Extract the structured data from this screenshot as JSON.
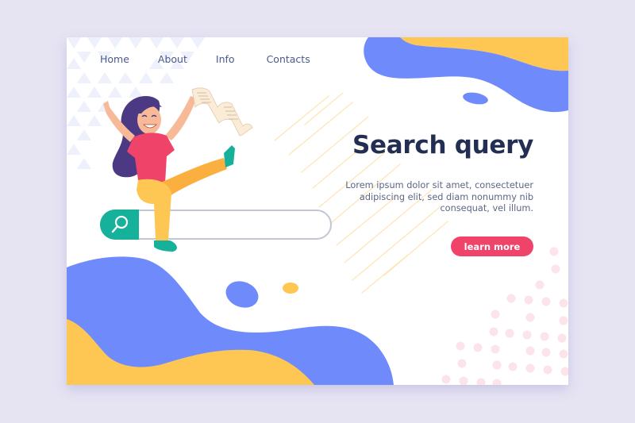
{
  "nav": {
    "items": [
      {
        "label": "Home"
      },
      {
        "label": "About"
      },
      {
        "label": "Info"
      },
      {
        "label": "Contacts"
      }
    ]
  },
  "hero": {
    "title": "Search query",
    "description": "Lorem ipsum dolor sit amet, consectetuer adipiscing elit, sed diam nonummy nib consequat, vel illum.",
    "cta_label": "learn more"
  },
  "search": {
    "value": "",
    "placeholder": "",
    "icon": "search-icon"
  },
  "illustration": {
    "subject": "woman-sitting-on-search-bar-holding-paper-scroll"
  },
  "colors": {
    "accent_blue": "#6f8bfb",
    "accent_yellow": "#fec754",
    "search_green": "#15b19a",
    "cta_pink": "#f0436a",
    "title_navy": "#232f52",
    "dots_pink": "#fde3ea"
  }
}
